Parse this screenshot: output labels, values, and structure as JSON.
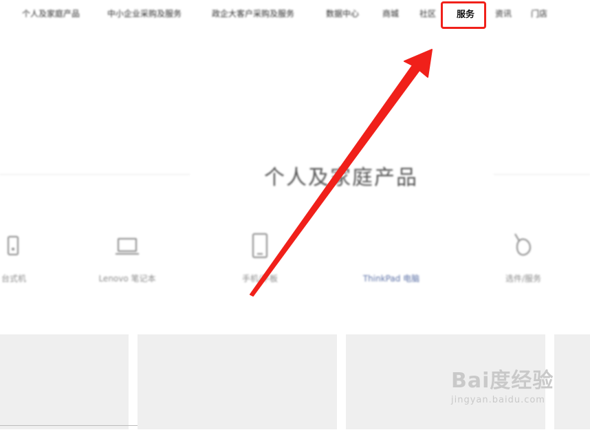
{
  "nav": {
    "items": [
      {
        "label": "个人及家庭产品"
      },
      {
        "label": "中小企业采购及服务"
      },
      {
        "label": "政企大客户采购及服务"
      },
      {
        "label": "数据中心"
      },
      {
        "label": "商城"
      },
      {
        "label": "社区"
      },
      {
        "label": "服务"
      },
      {
        "label": "资讯"
      },
      {
        "label": "门店"
      }
    ],
    "active_index": 6
  },
  "section": {
    "title": "个人及家庭产品"
  },
  "categories": [
    {
      "label": "台式机",
      "icon": "desktop-icon"
    },
    {
      "label": "Lenovo 笔记本",
      "icon": "laptop-icon"
    },
    {
      "label": "手机/平板",
      "icon": "tablet-icon"
    },
    {
      "label": "ThinkPad 电脑",
      "icon": "thinkpad-icon"
    },
    {
      "label": "选件/服务",
      "icon": "mouse-icon"
    }
  ],
  "annotation": {
    "arrow_color": "#f0201a",
    "box_color": "#f0201a"
  },
  "watermark": {
    "main": "Bai度经验",
    "sub": "jingyan.baidu.com"
  }
}
